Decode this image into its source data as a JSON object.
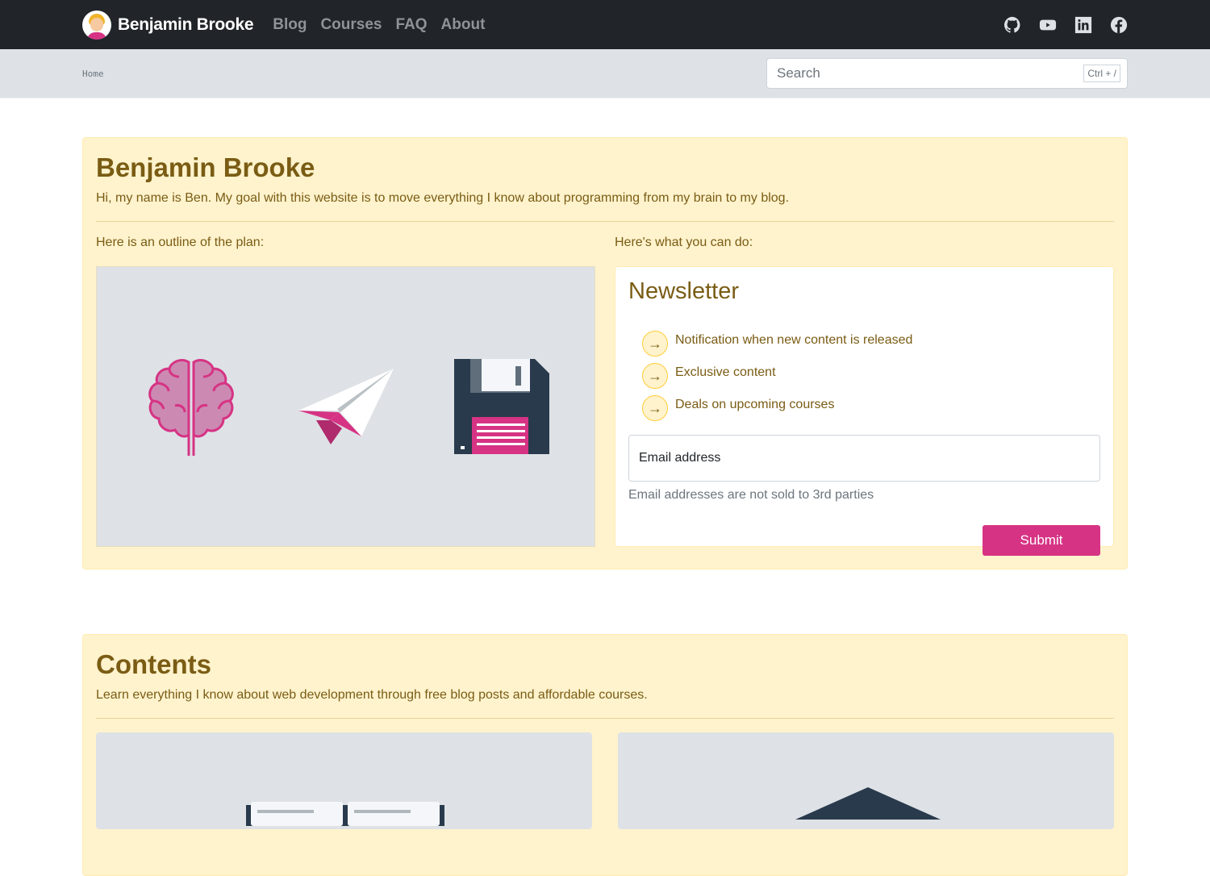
{
  "nav": {
    "brand": "Benjamin Brooke",
    "links": [
      "Blog",
      "Courses",
      "FAQ",
      "About"
    ],
    "social": [
      "github-icon",
      "youtube-icon",
      "linkedin-icon",
      "facebook-icon"
    ]
  },
  "breadcrumb": {
    "home": "Home"
  },
  "search": {
    "placeholder": "Search",
    "shortcut": "Ctrl + /"
  },
  "hero": {
    "title": "Benjamin Brooke",
    "lead": "Hi, my name is Ben. My goal with this website is to move everything I know about programming from my brain to my blog.",
    "left_label": "Here is an outline of the plan:",
    "right_label": "Here's what you can do:",
    "icons": [
      "brain-icon",
      "paper-plane-icon",
      "floppy-disk-icon"
    ]
  },
  "newsletter": {
    "title": "Newsletter",
    "items": [
      "Notification when new content is released",
      "Exclusive content",
      "Deals on upcoming courses"
    ],
    "email_placeholder": "Email address",
    "help": "Email addresses are not sold to 3rd parties",
    "submit": "Submit"
  },
  "contents": {
    "title": "Contents",
    "lead": "Learn everything I know about web development through free blog posts and affordable courses."
  },
  "colors": {
    "navbar": "#212529",
    "card": "#fff3cd",
    "accent": "#d63384",
    "text": "#7a5c14"
  }
}
